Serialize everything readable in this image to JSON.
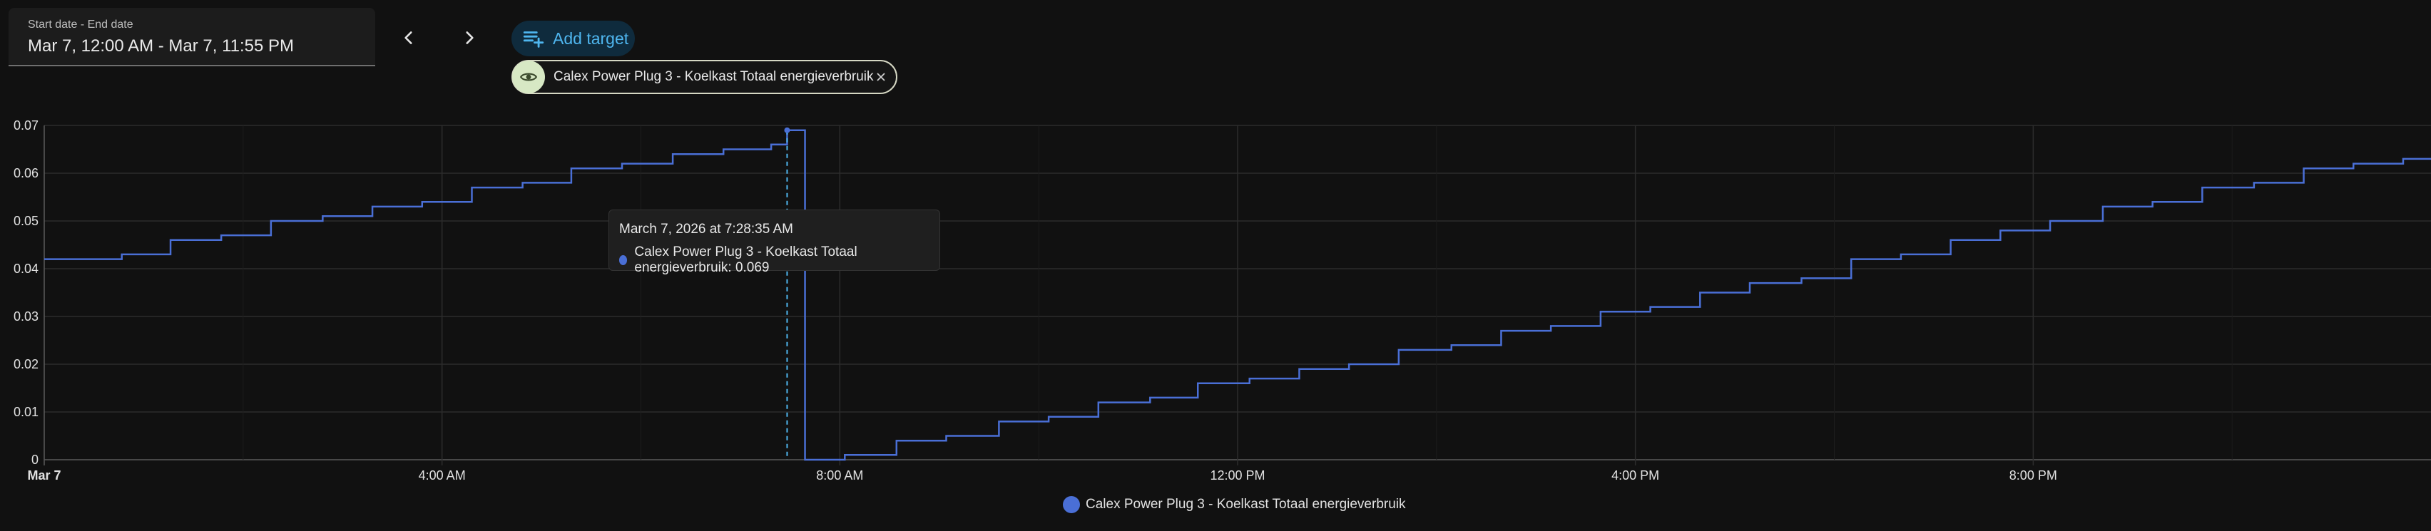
{
  "date_picker": {
    "label": "Start date - End date",
    "value": "Mar 7, 12:00 AM - Mar 7, 11:55 PM"
  },
  "nav": {
    "prev_icon": "chevron-left-icon",
    "next_icon": "chevron-right-icon"
  },
  "add_target": {
    "label": "Add target",
    "icon": "playlist-plus-icon"
  },
  "target_chip": {
    "label": "Calex Power Plug 3 - Koelkast Totaal energieverbruik",
    "icon": "eye-icon",
    "close_icon": "close-icon"
  },
  "tooltip": {
    "title": "March 7, 2026 at 7:28:35 AM",
    "series": "Calex Power Plug 3 - Koelkast Totaal energieverbruik",
    "value": "0.069",
    "line": "Calex Power Plug 3 - Koelkast Totaal energieverbruik: 0.069"
  },
  "legend": {
    "label": "Calex Power Plug 3 - Koelkast Totaal energieverbruik"
  },
  "colors": {
    "series": "#4a6fd6",
    "background": "#111111",
    "grid": "#2c2c2c",
    "accent": "#4fb6ef"
  },
  "chart_data": {
    "type": "line",
    "step": true,
    "x_unit": "hours",
    "xlim": [
      0,
      24
    ],
    "ylim": [
      0,
      0.07
    ],
    "y_ticks": [
      "0",
      "0.01",
      "0.02",
      "0.03",
      "0.04",
      "0.05",
      "0.06",
      "0.07"
    ],
    "y_tick_values": [
      0,
      0.01,
      0.02,
      0.03,
      0.04,
      0.05,
      0.06,
      0.07
    ],
    "x_ticks": [
      "Mar 7",
      "4:00 AM",
      "8:00 AM",
      "12:00 PM",
      "4:00 PM",
      "8:00 PM"
    ],
    "x_tick_values": [
      0,
      4,
      8,
      12,
      16,
      20
    ],
    "grid": true,
    "legend_position": "bottom",
    "series": [
      {
        "name": "Calex Power Plug 3 - Koelkast Totaal energieverbruik",
        "x": [
          0,
          0.78,
          1.27,
          1.78,
          2.28,
          2.8,
          3.3,
          3.8,
          4.3,
          4.81,
          5.3,
          5.81,
          6.32,
          6.83,
          7.31,
          7.47,
          7.65,
          8.05,
          8.57,
          9.07,
          9.6,
          10.1,
          10.6,
          11.12,
          11.6,
          12.12,
          12.62,
          13.12,
          13.62,
          14.15,
          14.65,
          15.15,
          15.65,
          16.15,
          16.65,
          17.15,
          17.67,
          18.17,
          18.67,
          19.17,
          19.67,
          20.17,
          20.7,
          21.2,
          21.7,
          22.22,
          22.72,
          23.22,
          23.72,
          24
        ],
        "y": [
          0.042,
          0.043,
          0.046,
          0.047,
          0.05,
          0.051,
          0.053,
          0.054,
          0.057,
          0.058,
          0.061,
          0.062,
          0.064,
          0.065,
          0.066,
          0.069,
          0,
          0.001,
          0.004,
          0.005,
          0.008,
          0.009,
          0.012,
          0.013,
          0.016,
          0.017,
          0.019,
          0.02,
          0.023,
          0.024,
          0.027,
          0.028,
          0.031,
          0.032,
          0.035,
          0.037,
          0.038,
          0.042,
          0.043,
          0.046,
          0.048,
          0.05,
          0.053,
          0.054,
          0.057,
          0.058,
          0.061,
          0.062,
          0.063,
          0.063
        ]
      }
    ],
    "highlight": {
      "x": 7.47,
      "y": 0.069
    }
  }
}
